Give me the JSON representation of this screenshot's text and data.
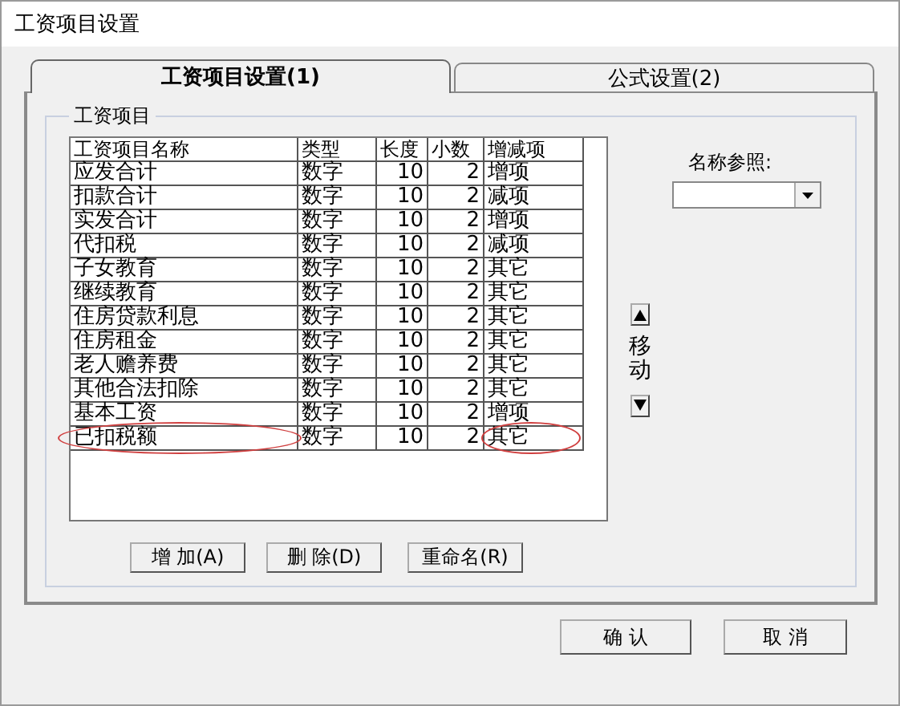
{
  "window": {
    "title": "工资项目设置"
  },
  "tabs": [
    {
      "label": "工资项目设置(1)",
      "selected": true
    },
    {
      "label": "公式设置(2)",
      "selected": false
    }
  ],
  "group": {
    "title": "工资项目"
  },
  "table": {
    "columns": [
      {
        "label": "工资项目名称",
        "kind": "text"
      },
      {
        "label": "类型",
        "kind": "text"
      },
      {
        "label": "长度",
        "kind": "number"
      },
      {
        "label": "小数",
        "kind": "number"
      },
      {
        "label": "增减项",
        "kind": "text"
      }
    ],
    "rows": [
      {
        "cells": [
          "应发合计",
          "数字",
          "10",
          "2",
          "增项"
        ],
        "circled": false
      },
      {
        "cells": [
          "扣款合计",
          "数字",
          "10",
          "2",
          "减项"
        ],
        "circled": false
      },
      {
        "cells": [
          "实发合计",
          "数字",
          "10",
          "2",
          "增项"
        ],
        "circled": false
      },
      {
        "cells": [
          "代扣税",
          "数字",
          "10",
          "2",
          "减项"
        ],
        "circled": false
      },
      {
        "cells": [
          "子女教育",
          "数字",
          "10",
          "2",
          "其它"
        ],
        "circled": false
      },
      {
        "cells": [
          "继续教育",
          "数字",
          "10",
          "2",
          "其它"
        ],
        "circled": false
      },
      {
        "cells": [
          "住房贷款利息",
          "数字",
          "10",
          "2",
          "其它"
        ],
        "circled": false
      },
      {
        "cells": [
          "住房租金",
          "数字",
          "10",
          "2",
          "其它"
        ],
        "circled": false
      },
      {
        "cells": [
          "老人赡养费",
          "数字",
          "10",
          "2",
          "其它"
        ],
        "circled": false
      },
      {
        "cells": [
          "其他合法扣除",
          "数字",
          "10",
          "2",
          "其它"
        ],
        "circled": false
      },
      {
        "cells": [
          "基本工资",
          "数字",
          "10",
          "2",
          "增项"
        ],
        "circled": false
      },
      {
        "cells": [
          "已扣税额",
          "数字",
          "10",
          "2",
          "其它"
        ],
        "circled": true
      }
    ]
  },
  "name_reference": {
    "label": "名称参照:"
  },
  "move": {
    "label": "移动"
  },
  "table_buttons": [
    "增 加(A)",
    "删 除(D)",
    "重命名(R)"
  ],
  "dialog_buttons": [
    "确 认",
    "取 消"
  ]
}
